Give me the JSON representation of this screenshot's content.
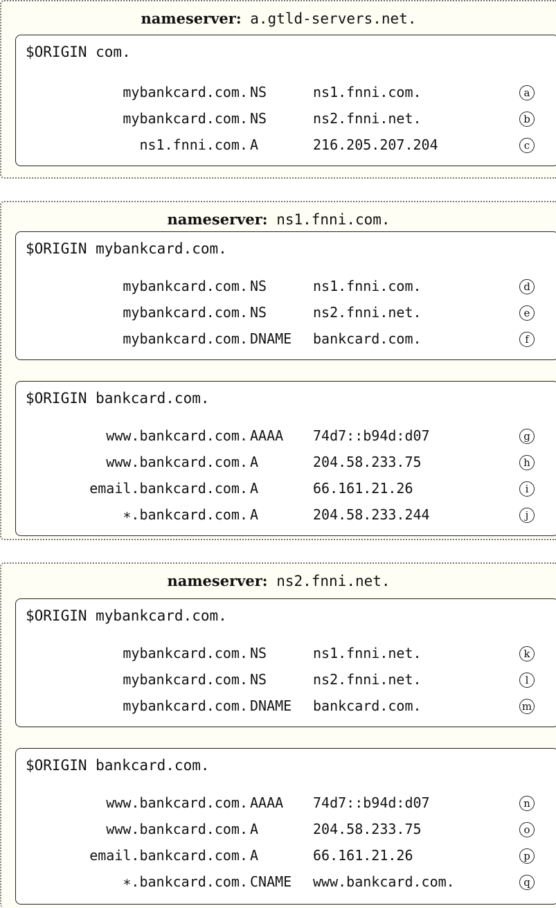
{
  "nameservers": [
    {
      "keyword": "nameserver:",
      "name": "a.gtld-servers.net.",
      "zones": [
        {
          "origin": "$ORIGIN com.",
          "records": [
            {
              "owner": "mybankcard.com.",
              "type": "NS",
              "rdata": "ns1.fnni.com.",
              "label": "a"
            },
            {
              "owner": "mybankcard.com.",
              "type": "NS",
              "rdata": "ns2.fnni.net.",
              "label": "b"
            },
            {
              "owner": "ns1.fnni.com.",
              "type": "A",
              "rdata": "216.205.207.204",
              "label": "c"
            }
          ]
        }
      ]
    },
    {
      "keyword": "nameserver:",
      "name": "ns1.fnni.com.",
      "zones": [
        {
          "origin": "$ORIGIN mybankcard.com.",
          "records": [
            {
              "owner": "mybankcard.com.",
              "type": "NS",
              "rdata": "ns1.fnni.com.",
              "label": "d"
            },
            {
              "owner": "mybankcard.com.",
              "type": "NS",
              "rdata": "ns2.fnni.net.",
              "label": "e"
            },
            {
              "owner": "mybankcard.com.",
              "type": "DNAME",
              "rdata": "bankcard.com.",
              "label": "f"
            }
          ]
        },
        {
          "origin": "$ORIGIN bankcard.com.",
          "records": [
            {
              "owner": "www.bankcard.com.",
              "type": "AAAA",
              "rdata": "74d7::b94d:d07",
              "label": "g"
            },
            {
              "owner": "www.bankcard.com.",
              "type": "A",
              "rdata": "204.58.233.75",
              "label": "h"
            },
            {
              "owner": "email.bankcard.com.",
              "type": "A",
              "rdata": "66.161.21.26",
              "label": "i"
            },
            {
              "owner": "∗.bankcard.com.",
              "type": "A",
              "rdata": "204.58.233.244",
              "label": "j"
            }
          ]
        }
      ]
    },
    {
      "keyword": "nameserver:",
      "name": "ns2.fnni.net.",
      "zones": [
        {
          "origin": "$ORIGIN mybankcard.com.",
          "records": [
            {
              "owner": "mybankcard.com.",
              "type": "NS",
              "rdata": "ns1.fnni.net.",
              "label": "k"
            },
            {
              "owner": "mybankcard.com.",
              "type": "NS",
              "rdata": "ns2.fnni.net.",
              "label": "l"
            },
            {
              "owner": "mybankcard.com.",
              "type": "DNAME",
              "rdata": "bankcard.com.",
              "label": "m"
            }
          ]
        },
        {
          "origin": "$ORIGIN bankcard.com.",
          "records": [
            {
              "owner": "www.bankcard.com.",
              "type": "AAAA",
              "rdata": "74d7::b94d:d07",
              "label": "n"
            },
            {
              "owner": "www.bankcard.com.",
              "type": "A",
              "rdata": "204.58.233.75",
              "label": "o"
            },
            {
              "owner": "email.bankcard.com.",
              "type": "A",
              "rdata": "66.161.21.26",
              "label": "p"
            },
            {
              "owner": "∗.bankcard.com.",
              "type": "CNAME",
              "rdata": "www.bankcard.com.",
              "label": "q"
            }
          ]
        }
      ]
    }
  ]
}
